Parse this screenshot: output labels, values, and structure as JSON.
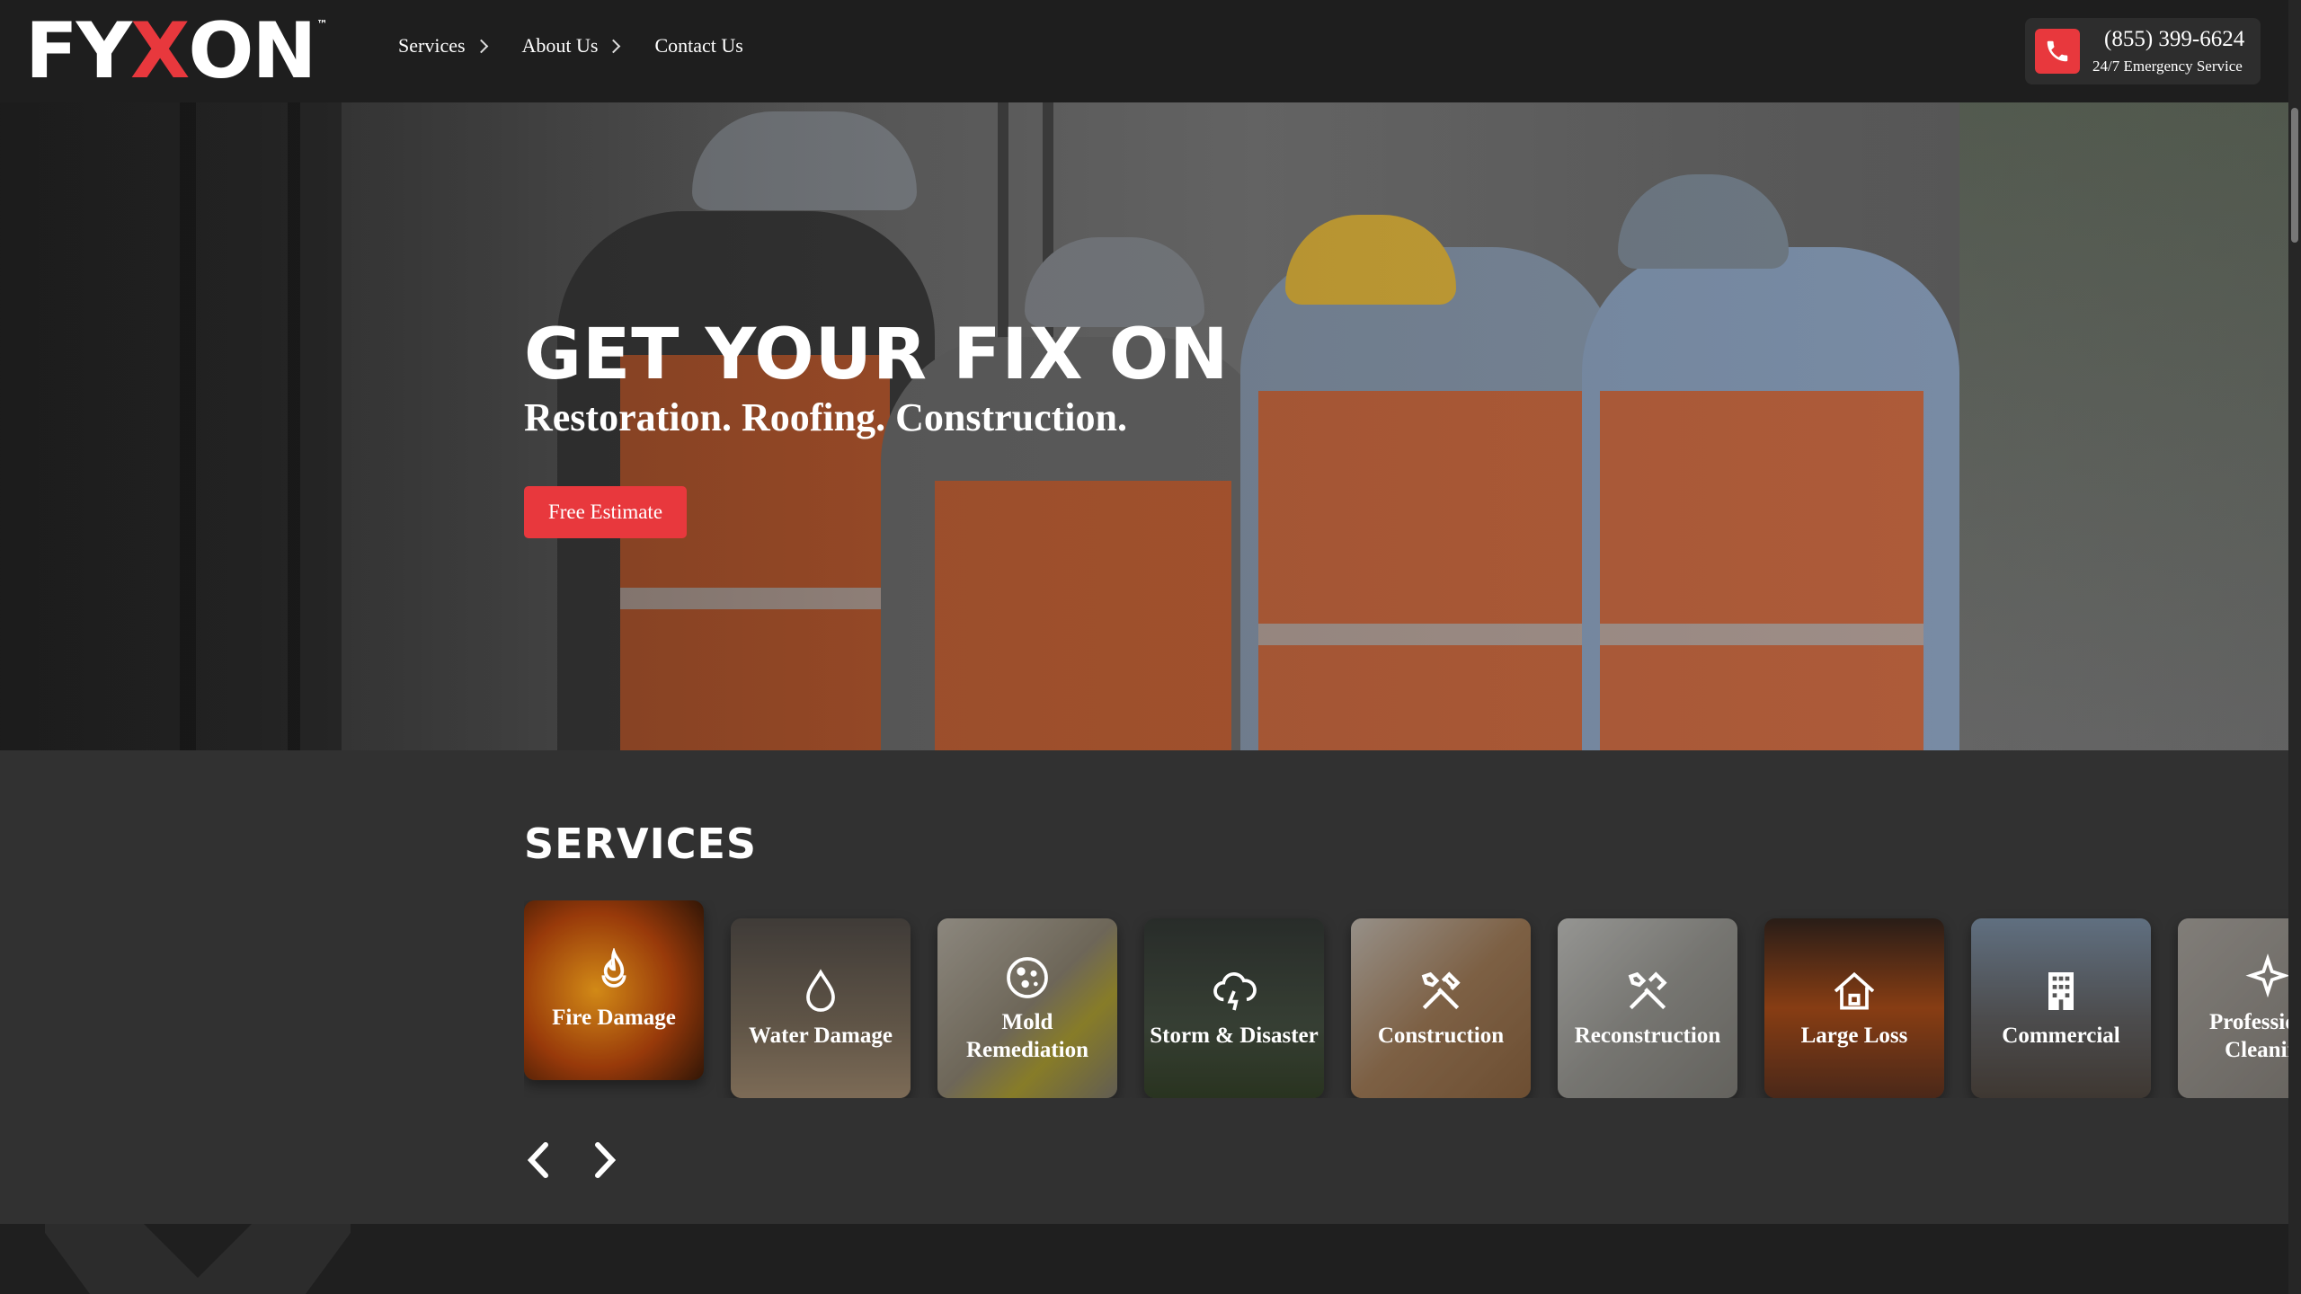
{
  "header": {
    "logo": {
      "part1": "FY",
      "part2": "X",
      "part3": "ON",
      "tm": "™"
    },
    "nav": [
      {
        "label": "Services",
        "has_chevron": true
      },
      {
        "label": "About Us",
        "has_chevron": true
      },
      {
        "label": "Contact Us",
        "has_chevron": false
      }
    ],
    "phone": {
      "number": "(855) 399-6624",
      "subtitle": "24/7 Emergency Service",
      "icon": "phone-icon"
    }
  },
  "hero": {
    "title": "GET YOUR FIX ON",
    "subtitle": "Restoration. Roofing. Construction.",
    "cta_label": "Free Estimate"
  },
  "services": {
    "title": "SERVICES",
    "items": [
      {
        "label": "Fire Damage",
        "icon": "flame-icon"
      },
      {
        "label": "Water Damage",
        "icon": "water-drop-icon"
      },
      {
        "label": "Mold Remediation",
        "icon": "mold-icon"
      },
      {
        "label": "Storm & Disaster",
        "icon": "storm-cloud-icon"
      },
      {
        "label": "Construction",
        "icon": "tools-icon"
      },
      {
        "label": "Reconstruction",
        "icon": "tools-icon"
      },
      {
        "label": "Large Loss",
        "icon": "house-fire-icon"
      },
      {
        "label": "Commercial",
        "icon": "building-icon"
      },
      {
        "label": "Professional Cleaning",
        "icon": "sparkle-icon"
      }
    ]
  },
  "colors": {
    "accent": "#e8383d",
    "header_bg": "#1e1e1e",
    "section_bg": "#313131"
  }
}
